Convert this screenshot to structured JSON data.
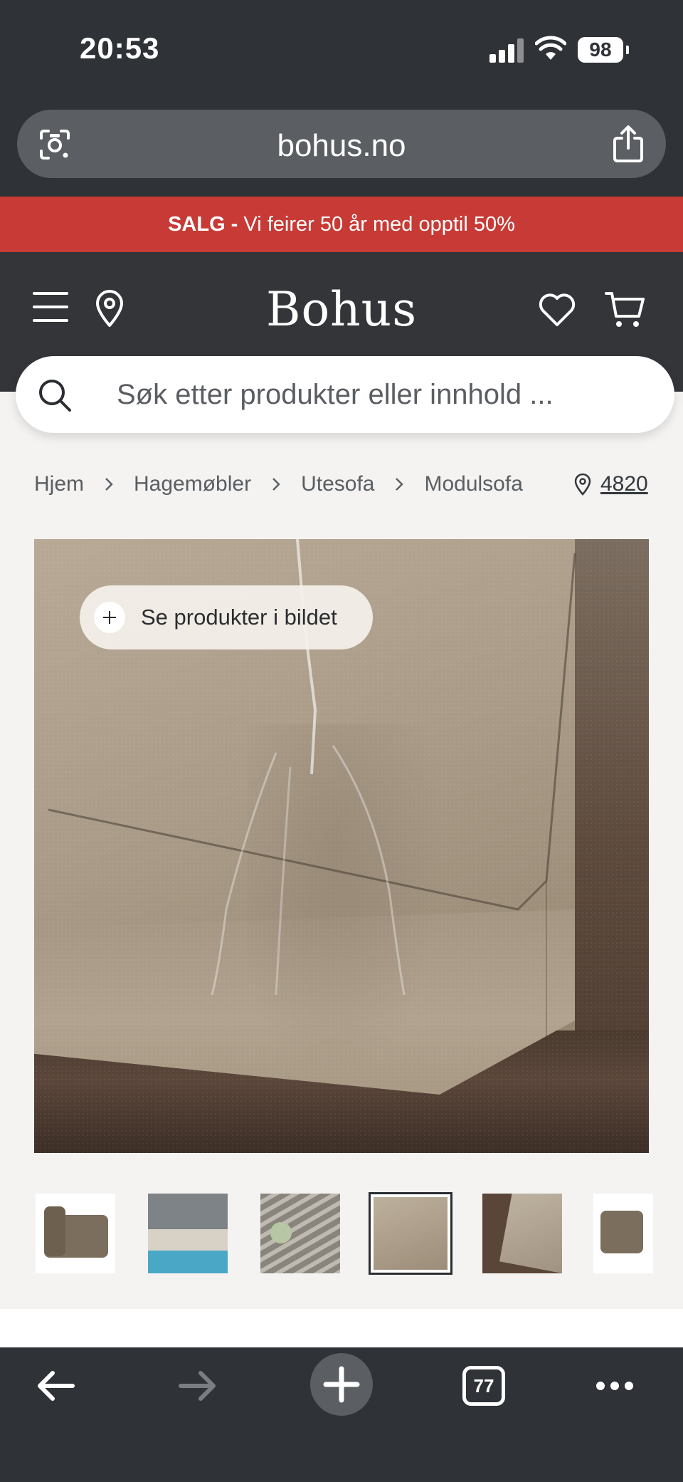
{
  "status_bar": {
    "time": "20:53",
    "battery": "98"
  },
  "browser": {
    "url": "bohus.no",
    "tab_count": "77"
  },
  "sale_banner": {
    "bold": "SALG -",
    "text": "Vi feirer 50 år med opptil 50%"
  },
  "header": {
    "logo": "Bohus"
  },
  "search": {
    "placeholder": "Søk etter produkter eller innhold ..."
  },
  "breadcrumb": {
    "items": [
      "Hjem",
      "Hagemøbler",
      "Utesofa",
      "Modulsofa"
    ],
    "store": "4820"
  },
  "product": {
    "tag_button": "Se produkter i bildet",
    "thumbnails": [
      {
        "name": "thumb-chair-white-bg",
        "active": false
      },
      {
        "name": "thumb-pool-lounge",
        "active": false
      },
      {
        "name": "thumb-terrace-aerial",
        "active": false
      },
      {
        "name": "thumb-water-resistant",
        "active": true
      },
      {
        "name": "thumb-fabric-closeup",
        "active": false
      },
      {
        "name": "thumb-module-white-bg",
        "active": false
      }
    ]
  },
  "colors": {
    "brand_dark": "#333539",
    "sale_red": "#c73a35",
    "page_bg": "#f4f3f1"
  }
}
